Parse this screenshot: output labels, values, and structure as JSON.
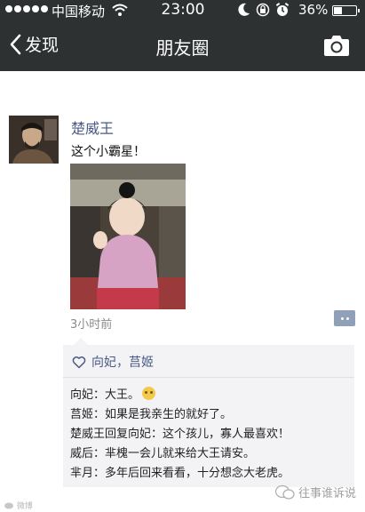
{
  "status_bar": {
    "carrier": "中国移动",
    "time": "23:00",
    "battery_percent": "36%",
    "battery_level": 0.36,
    "icons": [
      "signal-dots-icon",
      "wifi-icon",
      "moon-icon",
      "rotation-lock-icon",
      "alarm-icon",
      "battery-icon"
    ]
  },
  "nav": {
    "back_label": "发现",
    "title": "朋友圈",
    "right_icon": "camera-icon"
  },
  "post": {
    "author": "楚威王",
    "text": "这个小霸星！",
    "time": "3小时前",
    "likes": "向妃，莒姬",
    "comments": [
      {
        "user": "向妃：",
        "text": "大王。",
        "emoji": true
      },
      {
        "user": "莒姬：",
        "text": "如果是我亲生的就好了。"
      },
      {
        "user": "楚威王回复向妃：",
        "text": "这个孩儿，寡人最喜欢！"
      },
      {
        "user": "威后：",
        "text": "芈槐一会儿就来给大王请安。"
      },
      {
        "user": "芈月：",
        "text": "多年后回来看看，十分想念大老虎。"
      }
    ]
  },
  "watermarks": {
    "left": "微博",
    "right": "往事谁诉说"
  },
  "colors": {
    "nav_bg": "#2e3132",
    "name_link": "#4a5a85",
    "comment_bg": "#f3f3f5"
  }
}
